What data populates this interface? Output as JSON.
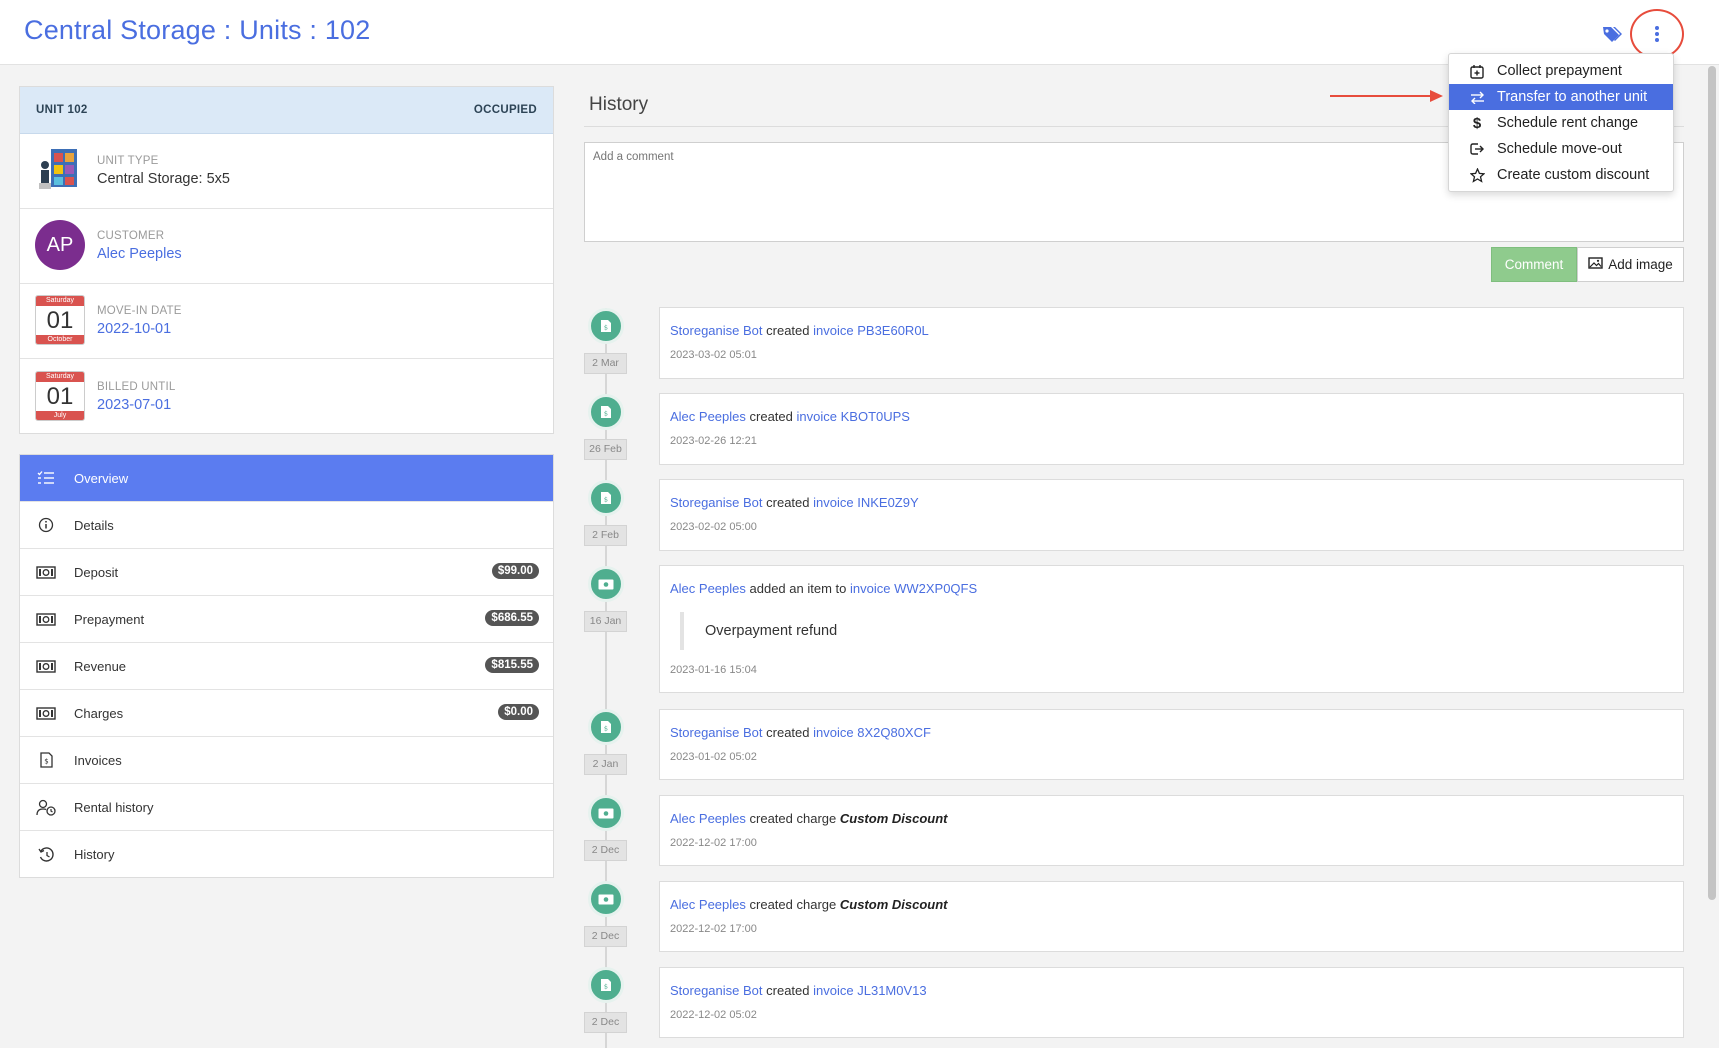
{
  "header": {
    "title": "Central Storage : Units : 102",
    "tags_icon": "tags-icon",
    "menu_icon": "kebab-menu-icon"
  },
  "dropdown": {
    "items": [
      {
        "label": "Collect prepayment",
        "icon": "calendar-plus-icon",
        "active": false
      },
      {
        "label": "Transfer to another unit",
        "icon": "transfer-arrows-icon",
        "active": true
      },
      {
        "label": "Schedule rent change",
        "icon": "dollar-icon",
        "active": false
      },
      {
        "label": "Schedule move-out",
        "icon": "exit-icon",
        "active": false
      },
      {
        "label": "Create custom discount",
        "icon": "star-icon",
        "active": false
      }
    ]
  },
  "unit": {
    "name": "UNIT 102",
    "status": "OCCUPIED",
    "unit_type_label": "UNIT TYPE",
    "unit_type_value": "Central Storage: 5x5",
    "customer_label": "CUSTOMER",
    "customer_initials": "AP",
    "customer_name": "Alec Peeples",
    "move_in_label": "MOVE-IN DATE",
    "move_in_value": "2022-10-01",
    "move_in_cal": {
      "weekday": "Saturday",
      "day": "01",
      "month": "October"
    },
    "billed_label": "BILLED UNTIL",
    "billed_value": "2023-07-01",
    "billed_cal": {
      "weekday": "Saturday",
      "day": "01",
      "month": "July"
    }
  },
  "nav": {
    "items": [
      {
        "label": "Overview",
        "icon": "list-icon",
        "active": true,
        "badge": ""
      },
      {
        "label": "Details",
        "icon": "info-icon",
        "active": false,
        "badge": ""
      },
      {
        "label": "Deposit",
        "icon": "money-icon",
        "active": false,
        "badge": "$99.00"
      },
      {
        "label": "Prepayment",
        "icon": "money-icon",
        "active": false,
        "badge": "$686.55"
      },
      {
        "label": "Revenue",
        "icon": "money-icon",
        "active": false,
        "badge": "$815.55"
      },
      {
        "label": "Charges",
        "icon": "money-icon",
        "active": false,
        "badge": "$0.00"
      },
      {
        "label": "Invoices",
        "icon": "invoice-icon",
        "active": false,
        "badge": ""
      },
      {
        "label": "Rental history",
        "icon": "user-clock-icon",
        "active": false,
        "badge": ""
      },
      {
        "label": "History",
        "icon": "history-icon",
        "active": false,
        "badge": ""
      }
    ]
  },
  "history": {
    "title": "History",
    "comment_placeholder": "Add a comment",
    "comment_button": "Comment",
    "add_image_button": "Add image",
    "events": [
      {
        "date": "2 Mar",
        "icon": "invoice-icon",
        "actor": "Storeganise Bot",
        "verb": "created",
        "obj_prefix": "invoice",
        "obj": "PB3E60R0L",
        "italic": "",
        "timestamp": "2023-03-02 05:01",
        "quote": ""
      },
      {
        "date": "26 Feb",
        "icon": "invoice-icon",
        "actor": "Alec Peeples",
        "verb": "created",
        "obj_prefix": "invoice",
        "obj": "KBOT0UPS",
        "italic": "",
        "timestamp": "2023-02-26 12:21",
        "quote": ""
      },
      {
        "date": "2 Feb",
        "icon": "invoice-icon",
        "actor": "Storeganise Bot",
        "verb": "created",
        "obj_prefix": "invoice",
        "obj": "INKE0Z9Y",
        "italic": "",
        "timestamp": "2023-02-02 05:00",
        "quote": ""
      },
      {
        "date": "16 Jan",
        "icon": "money-icon",
        "actor": "Alec Peeples",
        "verb": "added an item to",
        "obj_prefix": "invoice",
        "obj": "WW2XP0QFS",
        "italic": "",
        "timestamp": "2023-01-16 15:04",
        "quote": "Overpayment refund"
      },
      {
        "date": "2 Jan",
        "icon": "invoice-icon",
        "actor": "Storeganise Bot",
        "verb": "created",
        "obj_prefix": "invoice",
        "obj": "8X2Q80XCF",
        "italic": "",
        "timestamp": "2023-01-02 05:02",
        "quote": ""
      },
      {
        "date": "2 Dec",
        "icon": "money-icon",
        "actor": "Alec Peeples",
        "verb": "created charge",
        "obj_prefix": "",
        "obj": "",
        "italic": "Custom Discount",
        "timestamp": "2022-12-02 17:00",
        "quote": ""
      },
      {
        "date": "2 Dec",
        "icon": "money-icon",
        "actor": "Alec Peeples",
        "verb": "created charge",
        "obj_prefix": "",
        "obj": "",
        "italic": "Custom Discount",
        "timestamp": "2022-12-02 17:00",
        "quote": ""
      },
      {
        "date": "2 Dec",
        "icon": "invoice-icon",
        "actor": "Storeganise Bot",
        "verb": "created",
        "obj_prefix": "invoice",
        "obj": "JL31M0V13",
        "italic": "",
        "timestamp": "2022-12-02 05:02",
        "quote": ""
      }
    ]
  },
  "colors": {
    "accent": "#4a6ee0",
    "nav_active": "#5b7cf0",
    "timeline_dot": "#4fae8f",
    "comment_button": "#8fcb8d",
    "annotation": "#e74c3c"
  }
}
